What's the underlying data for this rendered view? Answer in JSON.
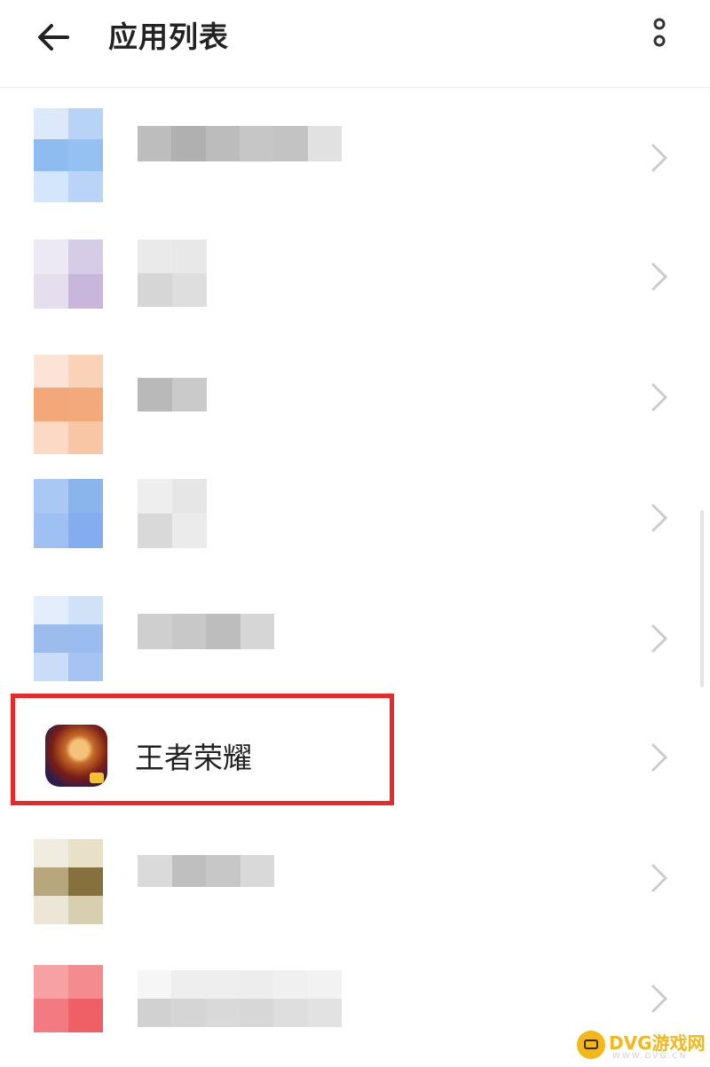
{
  "header": {
    "title": "应用列表",
    "back_icon": "arrow-left-icon",
    "more_icon": "more-vertical-icon"
  },
  "apps": [
    {
      "label": "",
      "note": "blurred",
      "chevron_icon": "chevron-right-icon"
    },
    {
      "label": "",
      "note": "blurred",
      "chevron_icon": "chevron-right-icon"
    },
    {
      "label": "",
      "note": "blurred",
      "chevron_icon": "chevron-right-icon"
    },
    {
      "label": "",
      "note": "blurred",
      "chevron_icon": "chevron-right-icon"
    },
    {
      "label": "",
      "note": "blurred",
      "chevron_icon": "chevron-right-icon"
    },
    {
      "label": "王者荣耀",
      "highlighted": true,
      "chevron_icon": "chevron-right-icon"
    },
    {
      "label": "",
      "note": "blurred",
      "chevron_icon": "chevron-right-icon"
    },
    {
      "label": "",
      "note": "blurred",
      "chevron_icon": "chevron-right-icon"
    }
  ],
  "colors": {
    "highlight_border": "#e8282b",
    "chevron": "#cccccc"
  },
  "watermark": {
    "text": "DVG游戏网",
    "sub": "WWW.DVG.CN"
  }
}
